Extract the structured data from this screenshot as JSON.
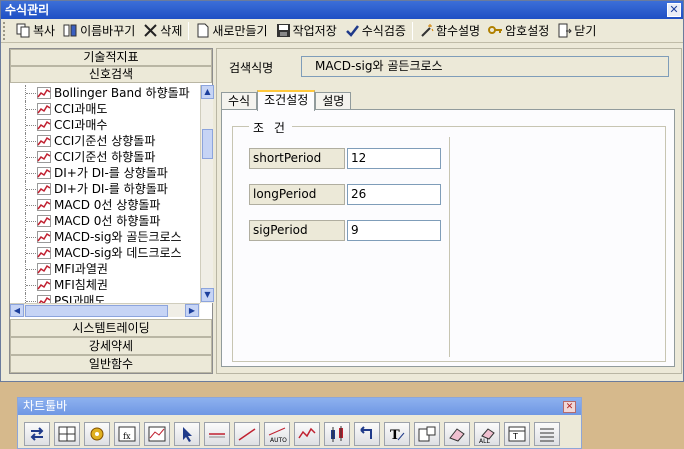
{
  "window": {
    "title": "수식관리"
  },
  "toolbar": [
    {
      "label": "복사",
      "icon": "copy-icon"
    },
    {
      "label": "이름바꾸기",
      "icon": "rename-icon"
    },
    {
      "label": "삭제",
      "icon": "delete-icon"
    },
    {
      "label": "새로만들기",
      "icon": "new-document-icon"
    },
    {
      "label": "작업저장",
      "icon": "save-icon"
    },
    {
      "label": "수식검증",
      "icon": "check-icon"
    },
    {
      "label": "함수설명",
      "icon": "magic-wand-icon"
    },
    {
      "label": "암호설정",
      "icon": "key-icon"
    },
    {
      "label": "닫기",
      "icon": "exit-door-icon"
    }
  ],
  "left": {
    "groups_top": [
      "기술적지표",
      "신호검색"
    ],
    "tree_items": [
      "Bollinger Band 하향돌파",
      "CCI과매도",
      "CCI과매수",
      "CCI기준선 상향돌파",
      "CCI기준선 하향돌파",
      "DI+가 DI-를 상향돌파",
      "DI+가 DI-를 하향돌파",
      "MACD 0선 상향돌파",
      "MACD 0선 하향돌파",
      "MACD-sig와 골든크로스",
      "MACD-sig와 데드크로스",
      "MFI과열권",
      "MFI침체권",
      "PSI과매도"
    ],
    "selected_index": 9,
    "groups_bottom": [
      "시스템트레이딩",
      "강세약세",
      "일반함수"
    ]
  },
  "right": {
    "name_label": "검색식명",
    "name_value": "MACD-sig와 골든크로스",
    "tabs": [
      "수식",
      "조건설정",
      "설명"
    ],
    "active_tab": 1,
    "condition_title": "조 건",
    "params": [
      {
        "label": "shortPeriod",
        "value": "12"
      },
      {
        "label": "longPeriod",
        "value": "26"
      },
      {
        "label": "sigPeriod",
        "value": "9"
      }
    ]
  },
  "chart_toolbar": {
    "title": "차트툴바",
    "buttons": [
      "swap-arrows-icon",
      "split-window-icon",
      "settings-gear-icon",
      "formula-fx-icon",
      "chart-grid-icon",
      "pointer-cursor-icon",
      "horizontal-line-icon",
      "trend-line-icon",
      "auto-trend-line-icon",
      "wave-line-icon",
      "candle-icon",
      "undo-arrow-icon",
      "text-tool-icon",
      "info-box-icon",
      "eraser-icon",
      "erase-all-icon",
      "table-icon",
      "list-icon"
    ]
  },
  "colors": {
    "titlebar": "#2456cf",
    "selection_text": "#000000",
    "toolbar_bg": "#ece9d8",
    "tree_icon": "#c02030"
  }
}
